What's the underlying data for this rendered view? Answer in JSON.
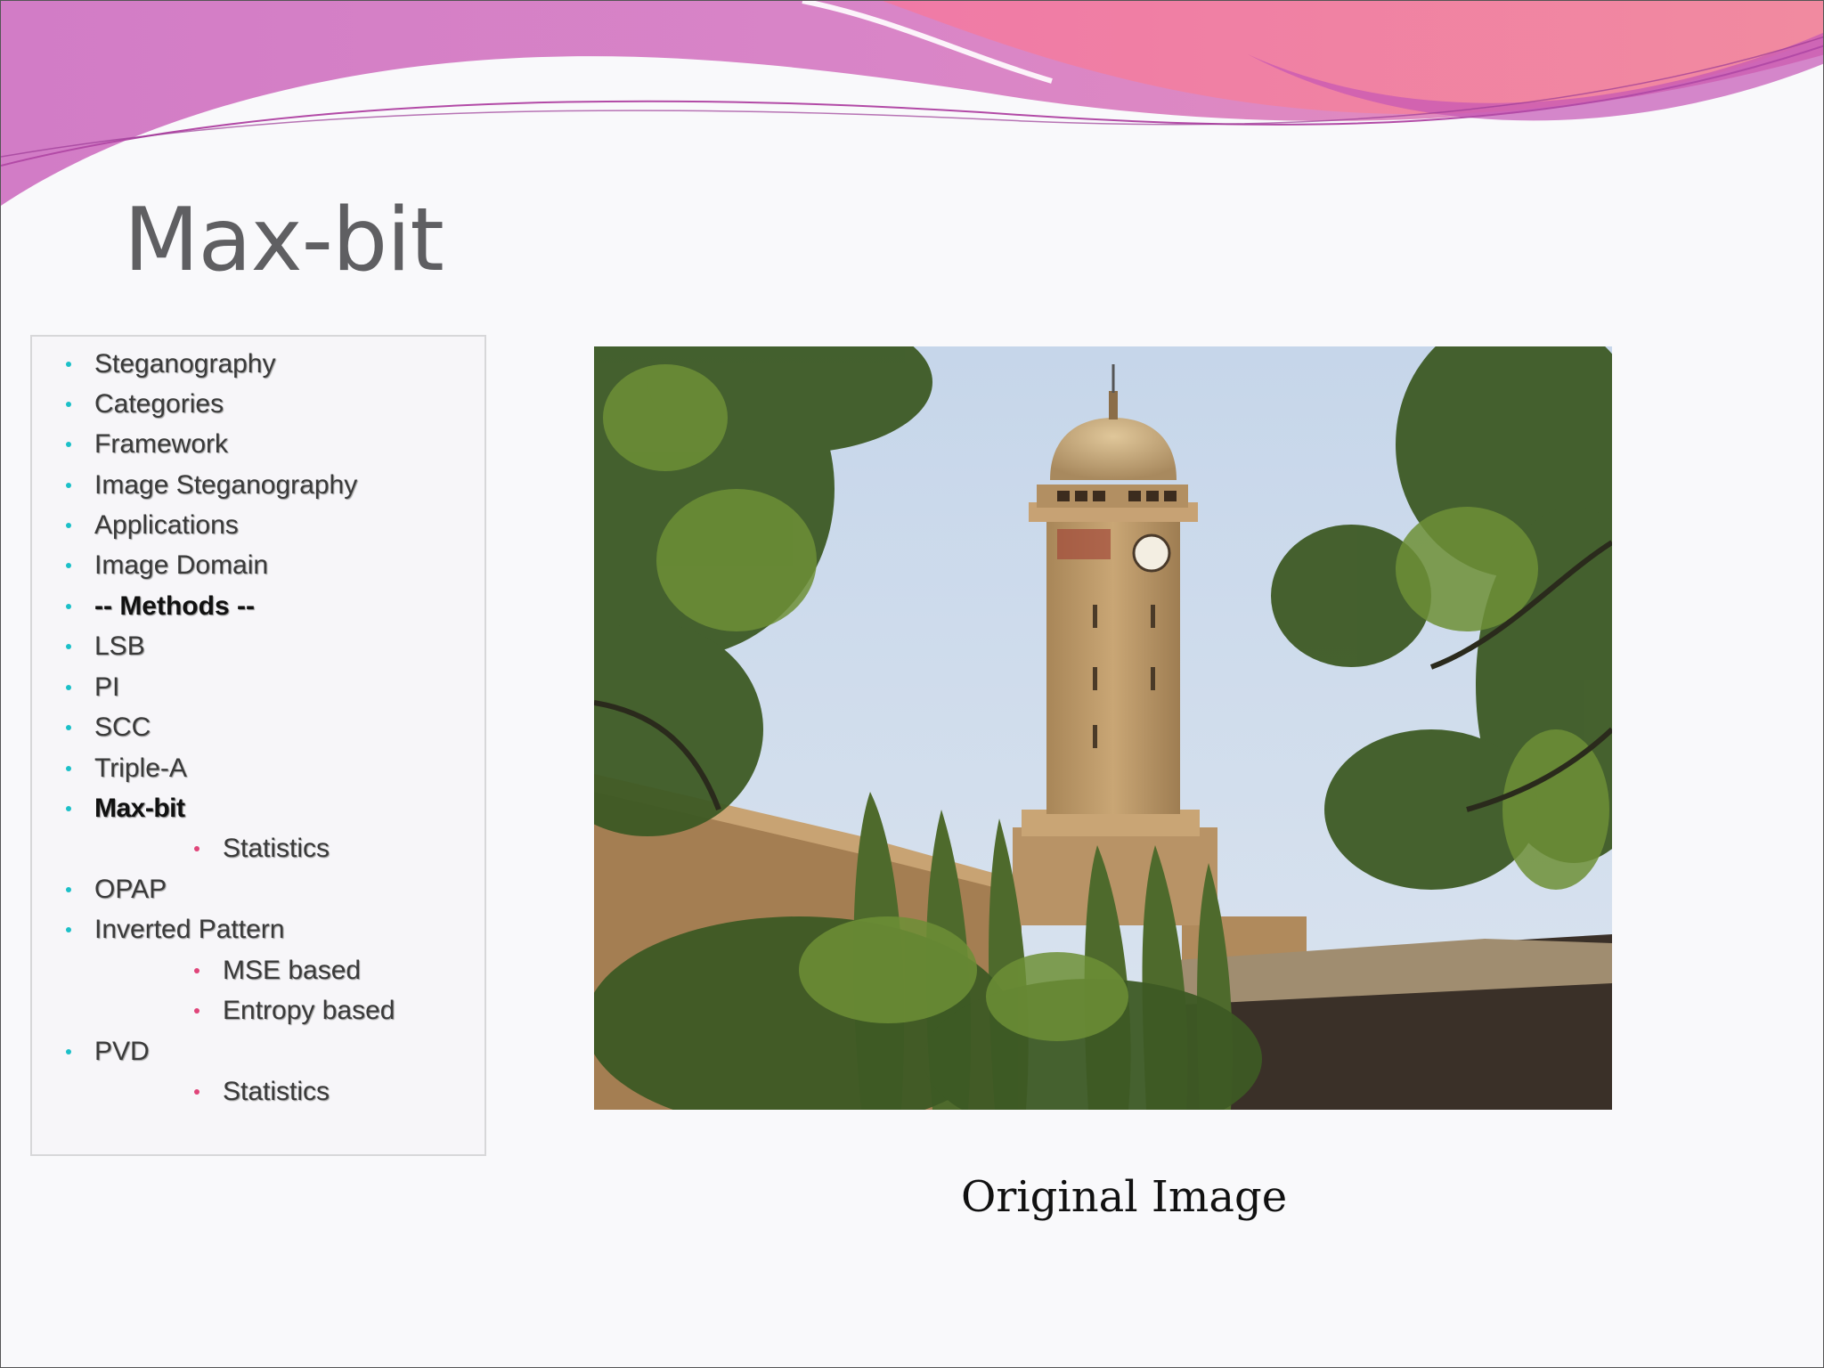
{
  "slide": {
    "title": "Max-bit",
    "caption": "Original Image",
    "accent_bullet_color": "#1cc0c8",
    "sub_bullet_color": "#e0457a",
    "wave_colors": [
      "#d57ec6",
      "#f27ea0",
      "#c455b5"
    ]
  },
  "nav": {
    "items": [
      {
        "label": "Steganography"
      },
      {
        "label": "Categories"
      },
      {
        "label": "Framework"
      },
      {
        "label": "Image Steganography"
      },
      {
        "label": "Applications"
      },
      {
        "label": "Image Domain"
      },
      {
        "label": "-- Methods --"
      },
      {
        "label": "LSB"
      },
      {
        "label": "PI"
      },
      {
        "label": "SCC"
      },
      {
        "label": "Triple-A"
      },
      {
        "label": "Max-bit"
      },
      {
        "label": "Statistics"
      },
      {
        "label": "OPAP"
      },
      {
        "label": "Inverted Pattern"
      },
      {
        "label": "MSE based"
      },
      {
        "label": "Entropy based"
      },
      {
        "label": "PVD"
      },
      {
        "label": "Statistics"
      }
    ]
  },
  "photo": {
    "subject": "clock-tower-photo"
  }
}
